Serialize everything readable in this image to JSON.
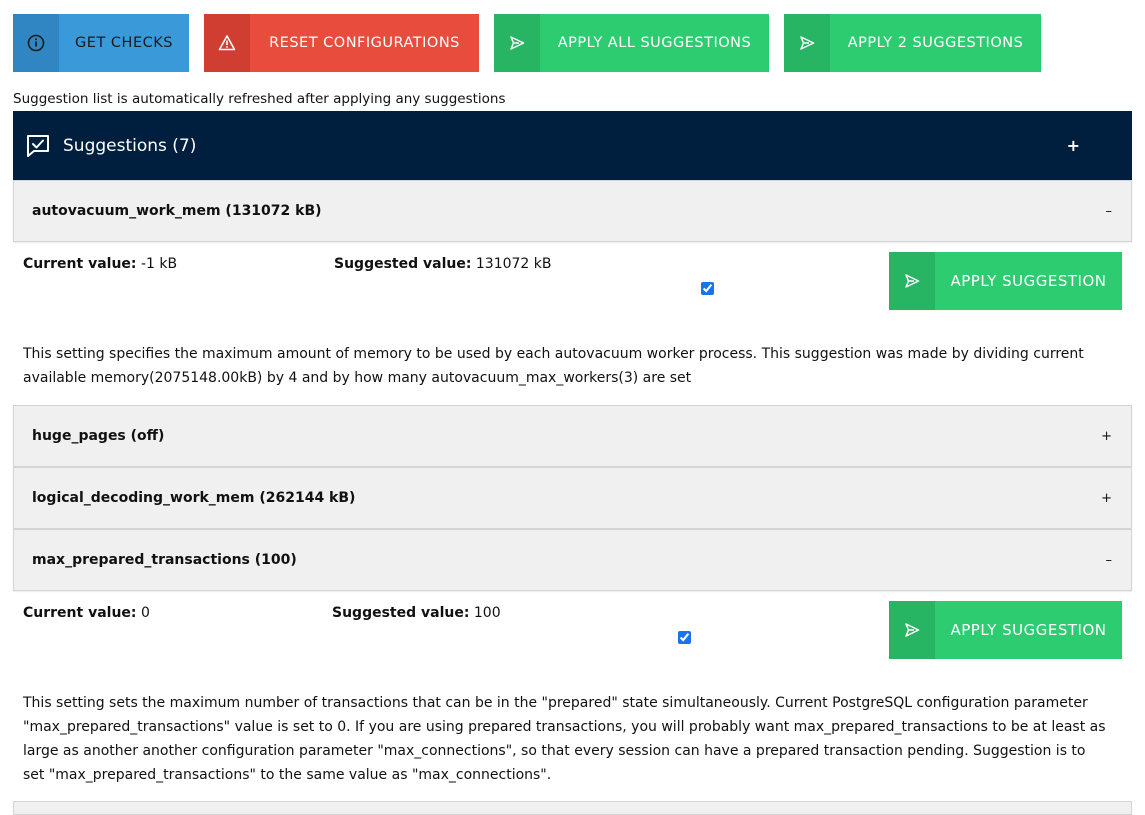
{
  "toolbar": {
    "get_checks": "GET CHECKS",
    "reset_configurations": "RESET CONFIGURATIONS",
    "apply_all": "APPLY ALL SUGGESTIONS",
    "apply_selected": "APPLY 2 SUGGESTIONS"
  },
  "note": "Suggestion list is automatically refreshed after applying any suggestions",
  "panel": {
    "title": "Suggestions (7)",
    "toggle": "+"
  },
  "labels": {
    "current": "Current value:",
    "suggested": "Suggested value:",
    "apply": "APPLY SUGGESTION"
  },
  "suggestions": [
    {
      "header": "autovacuum_work_mem (131072 kB)",
      "toggle": "–",
      "expanded": true,
      "current": "-1 kB",
      "suggested": "131072 kB",
      "checked": true,
      "description": "This setting specifies the maximum amount of memory to be used by each autovacuum worker process. This suggestion was made by dividing current available memory(2075148.00kB) by 4 and by how many autovacuum_max_workers(3) are set"
    },
    {
      "header": "huge_pages (off)",
      "toggle": "+",
      "expanded": false
    },
    {
      "header": "logical_decoding_work_mem (262144 kB)",
      "toggle": "+",
      "expanded": false
    },
    {
      "header": "max_prepared_transactions (100)",
      "toggle": "–",
      "expanded": true,
      "current": "0",
      "suggested": "100",
      "checked": true,
      "description": "This setting sets the maximum number of transactions that can be in the \"prepared\" state simultaneously. Current PostgreSQL configuration parameter \"max_prepared_transactions\" value is set to 0. If you are using prepared transactions, you will probably want max_prepared_transactions to be at least as large as another another configuration parameter \"max_connections\", so that every session can have a prepared transaction pending. Suggestion is to set \"max_prepared_transactions\" to the same value as \"max_connections\"."
    }
  ],
  "colors": {
    "blue": "#3a9ad9",
    "red": "#e74c3c",
    "green": "#2ecc71",
    "navy": "#001f3f"
  }
}
